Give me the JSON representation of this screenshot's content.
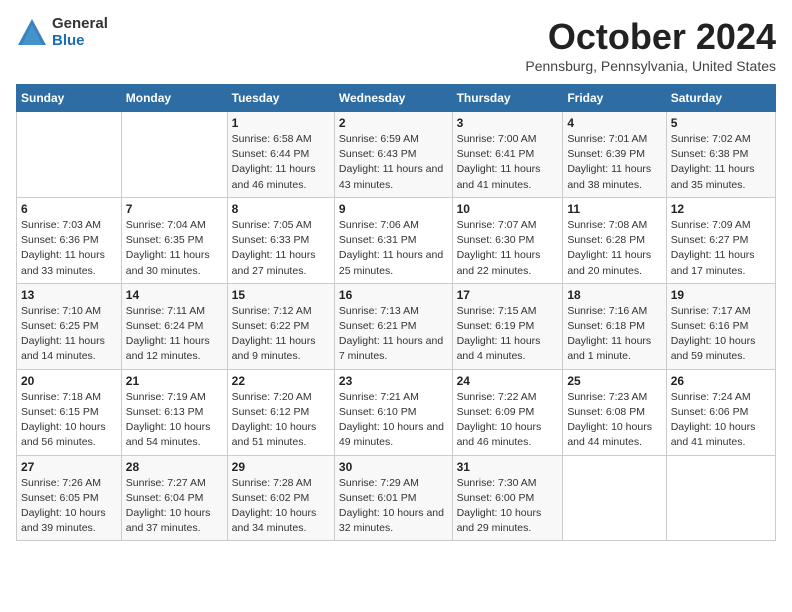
{
  "logo": {
    "general": "General",
    "blue": "Blue"
  },
  "title": "October 2024",
  "location": "Pennsburg, Pennsylvania, United States",
  "days_of_week": [
    "Sunday",
    "Monday",
    "Tuesday",
    "Wednesday",
    "Thursday",
    "Friday",
    "Saturday"
  ],
  "weeks": [
    [
      {
        "day": "",
        "info": ""
      },
      {
        "day": "",
        "info": ""
      },
      {
        "day": "1",
        "info": "Sunrise: 6:58 AM\nSunset: 6:44 PM\nDaylight: 11 hours and 46 minutes."
      },
      {
        "day": "2",
        "info": "Sunrise: 6:59 AM\nSunset: 6:43 PM\nDaylight: 11 hours and 43 minutes."
      },
      {
        "day": "3",
        "info": "Sunrise: 7:00 AM\nSunset: 6:41 PM\nDaylight: 11 hours and 41 minutes."
      },
      {
        "day": "4",
        "info": "Sunrise: 7:01 AM\nSunset: 6:39 PM\nDaylight: 11 hours and 38 minutes."
      },
      {
        "day": "5",
        "info": "Sunrise: 7:02 AM\nSunset: 6:38 PM\nDaylight: 11 hours and 35 minutes."
      }
    ],
    [
      {
        "day": "6",
        "info": "Sunrise: 7:03 AM\nSunset: 6:36 PM\nDaylight: 11 hours and 33 minutes."
      },
      {
        "day": "7",
        "info": "Sunrise: 7:04 AM\nSunset: 6:35 PM\nDaylight: 11 hours and 30 minutes."
      },
      {
        "day": "8",
        "info": "Sunrise: 7:05 AM\nSunset: 6:33 PM\nDaylight: 11 hours and 27 minutes."
      },
      {
        "day": "9",
        "info": "Sunrise: 7:06 AM\nSunset: 6:31 PM\nDaylight: 11 hours and 25 minutes."
      },
      {
        "day": "10",
        "info": "Sunrise: 7:07 AM\nSunset: 6:30 PM\nDaylight: 11 hours and 22 minutes."
      },
      {
        "day": "11",
        "info": "Sunrise: 7:08 AM\nSunset: 6:28 PM\nDaylight: 11 hours and 20 minutes."
      },
      {
        "day": "12",
        "info": "Sunrise: 7:09 AM\nSunset: 6:27 PM\nDaylight: 11 hours and 17 minutes."
      }
    ],
    [
      {
        "day": "13",
        "info": "Sunrise: 7:10 AM\nSunset: 6:25 PM\nDaylight: 11 hours and 14 minutes."
      },
      {
        "day": "14",
        "info": "Sunrise: 7:11 AM\nSunset: 6:24 PM\nDaylight: 11 hours and 12 minutes."
      },
      {
        "day": "15",
        "info": "Sunrise: 7:12 AM\nSunset: 6:22 PM\nDaylight: 11 hours and 9 minutes."
      },
      {
        "day": "16",
        "info": "Sunrise: 7:13 AM\nSunset: 6:21 PM\nDaylight: 11 hours and 7 minutes."
      },
      {
        "day": "17",
        "info": "Sunrise: 7:15 AM\nSunset: 6:19 PM\nDaylight: 11 hours and 4 minutes."
      },
      {
        "day": "18",
        "info": "Sunrise: 7:16 AM\nSunset: 6:18 PM\nDaylight: 11 hours and 1 minute."
      },
      {
        "day": "19",
        "info": "Sunrise: 7:17 AM\nSunset: 6:16 PM\nDaylight: 10 hours and 59 minutes."
      }
    ],
    [
      {
        "day": "20",
        "info": "Sunrise: 7:18 AM\nSunset: 6:15 PM\nDaylight: 10 hours and 56 minutes."
      },
      {
        "day": "21",
        "info": "Sunrise: 7:19 AM\nSunset: 6:13 PM\nDaylight: 10 hours and 54 minutes."
      },
      {
        "day": "22",
        "info": "Sunrise: 7:20 AM\nSunset: 6:12 PM\nDaylight: 10 hours and 51 minutes."
      },
      {
        "day": "23",
        "info": "Sunrise: 7:21 AM\nSunset: 6:10 PM\nDaylight: 10 hours and 49 minutes."
      },
      {
        "day": "24",
        "info": "Sunrise: 7:22 AM\nSunset: 6:09 PM\nDaylight: 10 hours and 46 minutes."
      },
      {
        "day": "25",
        "info": "Sunrise: 7:23 AM\nSunset: 6:08 PM\nDaylight: 10 hours and 44 minutes."
      },
      {
        "day": "26",
        "info": "Sunrise: 7:24 AM\nSunset: 6:06 PM\nDaylight: 10 hours and 41 minutes."
      }
    ],
    [
      {
        "day": "27",
        "info": "Sunrise: 7:26 AM\nSunset: 6:05 PM\nDaylight: 10 hours and 39 minutes."
      },
      {
        "day": "28",
        "info": "Sunrise: 7:27 AM\nSunset: 6:04 PM\nDaylight: 10 hours and 37 minutes."
      },
      {
        "day": "29",
        "info": "Sunrise: 7:28 AM\nSunset: 6:02 PM\nDaylight: 10 hours and 34 minutes."
      },
      {
        "day": "30",
        "info": "Sunrise: 7:29 AM\nSunset: 6:01 PM\nDaylight: 10 hours and 32 minutes."
      },
      {
        "day": "31",
        "info": "Sunrise: 7:30 AM\nSunset: 6:00 PM\nDaylight: 10 hours and 29 minutes."
      },
      {
        "day": "",
        "info": ""
      },
      {
        "day": "",
        "info": ""
      }
    ]
  ]
}
